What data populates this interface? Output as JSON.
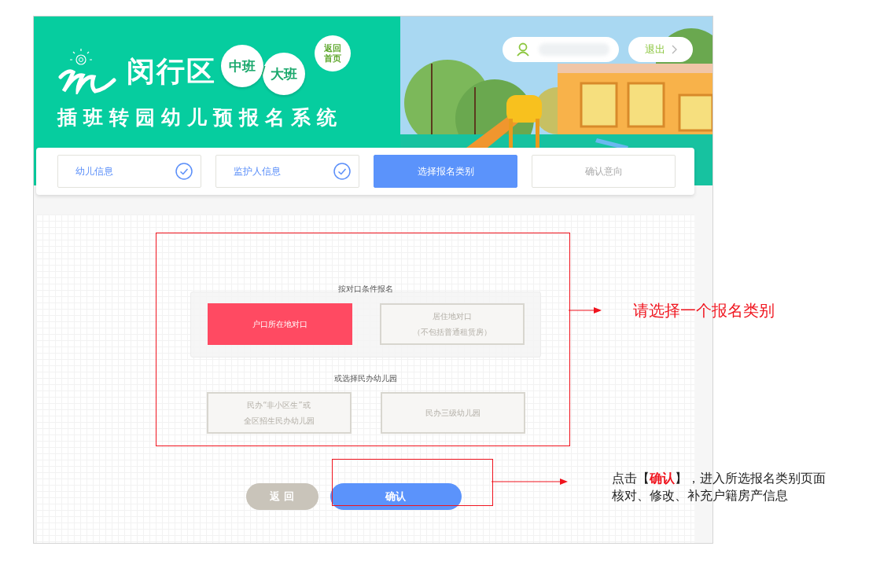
{
  "header": {
    "district": "闵行区",
    "grades": [
      "中班",
      "大班"
    ],
    "grade_separator": "/",
    "home_link": [
      "返回",
      "首页"
    ],
    "system_title": "插班转园幼儿预报名系统",
    "logout": "退出"
  },
  "steps": [
    {
      "label": "幼儿信息",
      "completed": true,
      "selected": false
    },
    {
      "label": "监护人信息",
      "completed": true,
      "selected": false
    },
    {
      "label": "选择报名类别",
      "completed": false,
      "selected": true
    },
    {
      "label": "确认意向",
      "completed": false,
      "selected": false
    }
  ],
  "groups": [
    {
      "title": "按对口条件报名",
      "kind": "boxed",
      "options": [
        {
          "lines": [
            "户口所在地对口"
          ],
          "selected": true
        },
        {
          "lines": [
            "居住地对口",
            "（不包括普通租赁房）"
          ],
          "selected": false
        }
      ]
    },
    {
      "title": "或选择民办幼儿园",
      "kind": "plain",
      "options": [
        {
          "lines": [
            "民办“非小区生”或",
            "全区招生民办幼儿园"
          ],
          "selected": false
        },
        {
          "lines": [
            "民办三级幼儿园"
          ],
          "selected": false
        }
      ]
    }
  ],
  "buttons": [
    {
      "label": "返 回",
      "kind": "back"
    },
    {
      "label": "确认",
      "kind": "confirm"
    }
  ],
  "annotations": [
    {
      "text": "请选择一个报名类别",
      "kind": "large"
    },
    {
      "text": "点击【**确认**】，进入所选报名类别页面核对、修改、补充户籍房产信息",
      "kind": "small"
    }
  ]
}
